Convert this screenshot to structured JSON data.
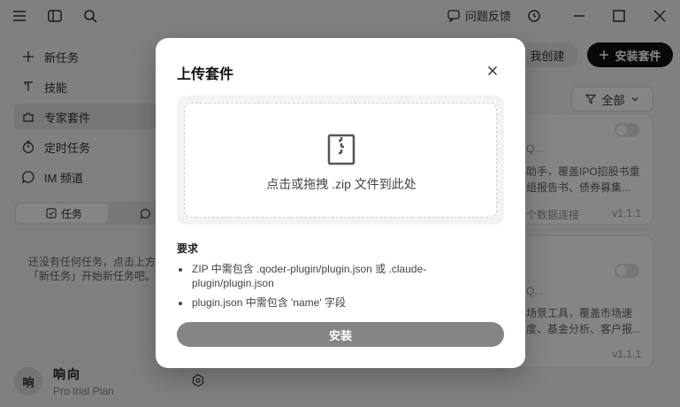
{
  "titlebar": {
    "feedback_label": "问题反馈"
  },
  "sidebar": {
    "items": [
      {
        "label": "新任务",
        "icon": "plus-icon"
      },
      {
        "label": "技能",
        "icon": "tool-icon"
      },
      {
        "label": "专家套件",
        "icon": "puzzle-icon"
      },
      {
        "label": "定时任务",
        "icon": "timer-icon"
      },
      {
        "label": "IM 频道",
        "icon": "chat-icon"
      }
    ],
    "tabs": {
      "tasks_label": "任务"
    },
    "empty_text": "还没有任何任务，点击上方「新任务」开始新任务吧。",
    "user": {
      "avatar_text": "响",
      "name": "响向",
      "plan": "Pro trial Plan"
    }
  },
  "main": {
    "mine_label": "我创建",
    "install_suite_label": "安装套件",
    "filter_label": "全部",
    "cards": [
      {
        "title_frag": "Q...",
        "desc": "助手，覆盖IPO招股书重组报告书、债券募集...",
        "foot_left": "个数据连接",
        "version": "v1.1.1"
      },
      {
        "title_frag": "Q...",
        "desc": "场景工具，覆盖市场速度、基金分析、客户报...",
        "foot_left": "",
        "version": "v1.1.1"
      }
    ]
  },
  "modal": {
    "title": "上传套件",
    "drop_text": "点击或拖拽 .zip 文件到此处",
    "requirements_title": "要求",
    "requirements": [
      "ZIP 中需包含 .qoder-plugin/plugin.json 或 .claude-plugin/plugin.json",
      "plugin.json 中需包含 'name' 字段"
    ],
    "install_label": "安装"
  },
  "colors": {
    "overlay": "#000000",
    "primary_button": "#111111",
    "disabled_button": "#858585"
  }
}
